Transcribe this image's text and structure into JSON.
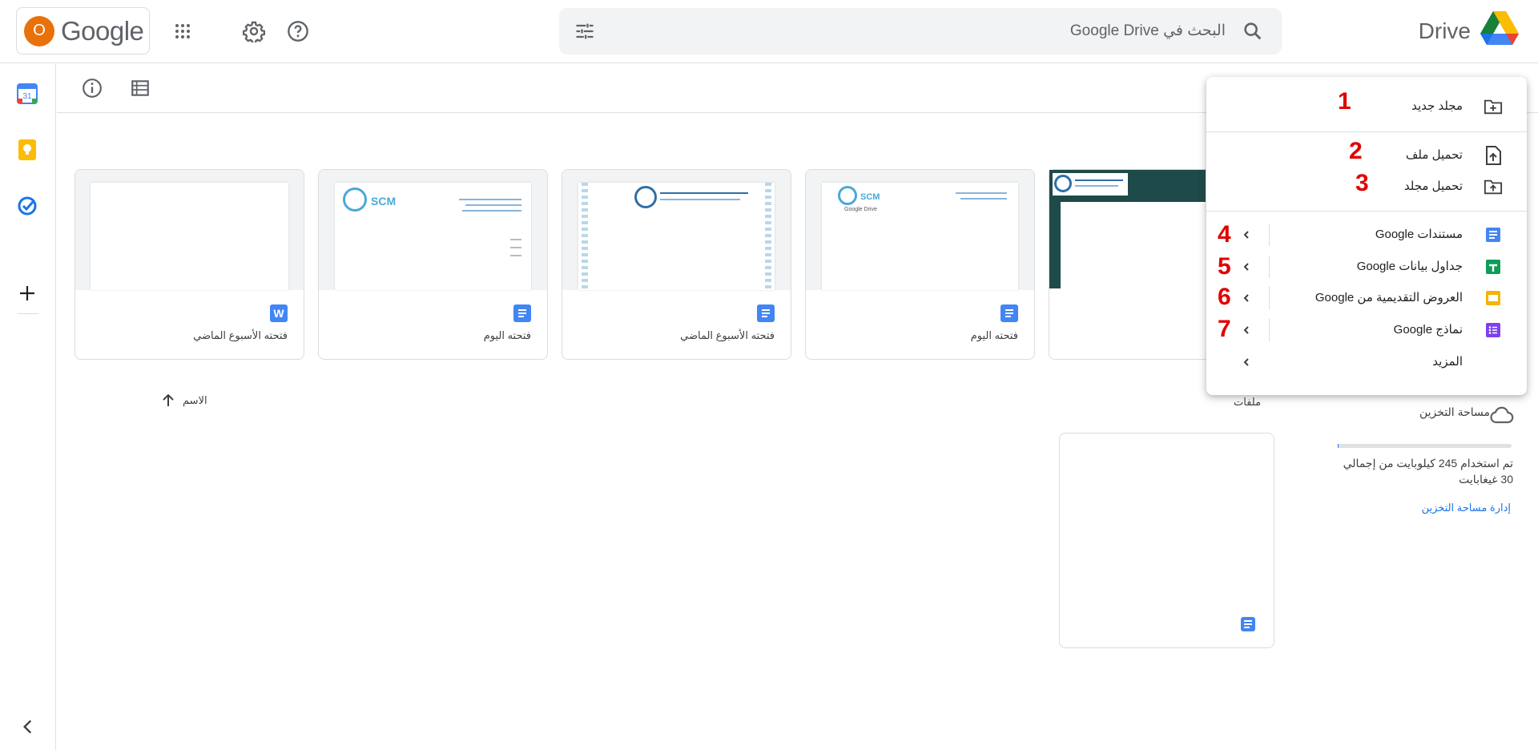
{
  "header": {
    "avatar_letter": "O",
    "google_label": "Google",
    "search_placeholder": "البحث في Google Drive",
    "brand": "Drive"
  },
  "icons": {
    "apps": "apps-grid-icon",
    "settings": "gear-icon",
    "help": "help-icon",
    "tune": "tune-icon",
    "search": "search-icon",
    "drive_logo": "drive-logo-icon"
  },
  "cards": [
    {
      "caption": "فتحته الأسبوع الماضي",
      "type": "word"
    },
    {
      "caption": "فتحته اليوم",
      "type": "docs"
    },
    {
      "caption": "فتحته الأسبوع الماضي",
      "type": "docs"
    },
    {
      "caption": "فتحته اليوم",
      "type": "docs"
    }
  ],
  "thumb_texts": {
    "scm": "SCM",
    "drive_mini": "Google Drive"
  },
  "sort": {
    "label": "الاسم"
  },
  "files_label": "ملفات",
  "storage": {
    "title": "مساحة التخزين",
    "usage_text": "تم استخدام 245 كيلوبايت من إجمالي 30 غيغابايت",
    "usage_fraction": 1e-05,
    "manage_link": "إدارة مساحة التخزين"
  },
  "menu": {
    "items": [
      {
        "label": "مجلد جديد",
        "number": "1"
      },
      {
        "label": "تحميل ملف",
        "number": "2"
      },
      {
        "label": "تحميل مجلد",
        "number": "3"
      },
      {
        "label": "مستندات Google",
        "number": "4"
      },
      {
        "label": "جداول بيانات Google",
        "number": "5"
      },
      {
        "label": "العروض التقديمية من Google",
        "number": "6"
      },
      {
        "label": "نماذج Google",
        "number": "7"
      },
      {
        "label": "المزيد",
        "number": ""
      }
    ]
  },
  "colors": {
    "docs_blue": "#4285f4",
    "sheets_green": "#0f9d58",
    "slides_yellow": "#f4b400",
    "forms_purple": "#7e3ff2",
    "annotation_red": "#e00000"
  }
}
